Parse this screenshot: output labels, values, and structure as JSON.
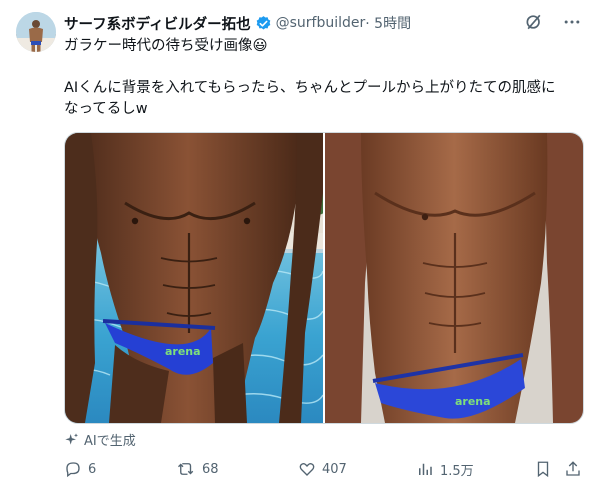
{
  "tweet": {
    "display_name": "サーフ系ボディビルダー拓也",
    "handle": "@surfbuilder",
    "time": " · 5時間",
    "text": "ガラケー時代の待ち受け画像😃\n\nAIくんに背景を入れてもらったら、ちゃんとプールから上がりたての肌感に\nなってるしw",
    "ai_label": "AIで生成",
    "brand_left": "arena",
    "brand_right": "arena"
  },
  "actions": {
    "replies": "6",
    "reposts": "68",
    "likes": "407",
    "views": "1.5万"
  },
  "colors": {
    "verified": "#1d9bf0",
    "text": "#0f1419",
    "secondary": "#536471"
  },
  "icons": [
    "grok-icon",
    "more-icon",
    "sparkle-icon",
    "reply-icon",
    "repost-icon",
    "like-icon",
    "views-icon",
    "bookmark-icon",
    "share-icon"
  ]
}
